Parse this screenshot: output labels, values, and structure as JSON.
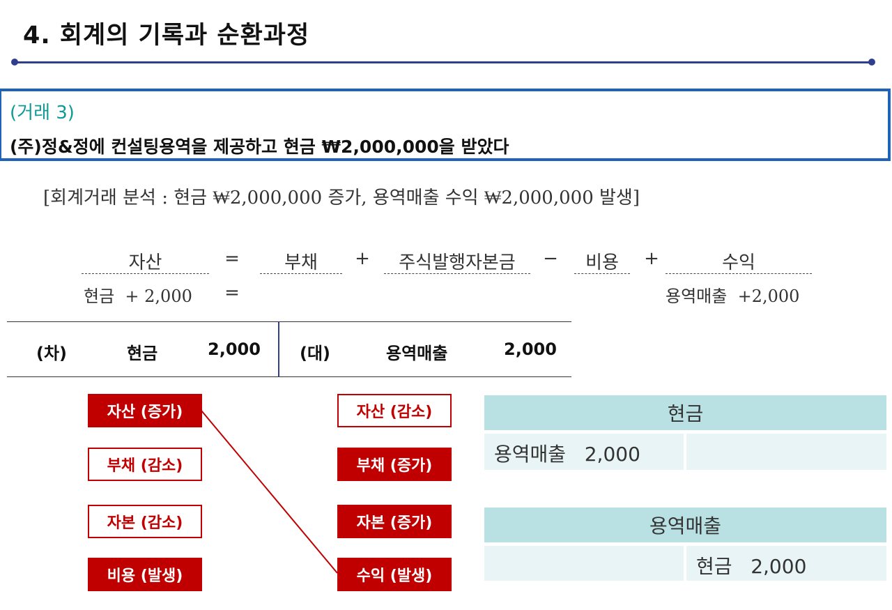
{
  "title": "4. 회계의 기록과 순환과정",
  "transaction": {
    "number": "(거래 3)",
    "description": "(주)정&정에 컨설팅용역을 제공하고 현금 ₩2,000,000을 받았다"
  },
  "analysis": "[회계거래 분석 : 현금 ₩2,000,000 증가, 용역매출 수익 ₩2,000,000 발생]",
  "equation": {
    "terms": [
      "자산",
      "부채",
      "주식발행자본금",
      "비용",
      "수익"
    ],
    "operators": [
      "=",
      "+",
      "−",
      "+"
    ],
    "row_left": "현금  + 2,000",
    "row_equals": "=",
    "row_right": "용역매출  +2,000"
  },
  "journal": {
    "debit_label": "(차)",
    "debit_account": "현금",
    "debit_amount": "2,000",
    "credit_label": "(대)",
    "credit_account": "용역매출",
    "credit_amount": "2,000"
  },
  "debit_tags": [
    {
      "label": "자산 (증가)",
      "style": "filled"
    },
    {
      "label": "부채 (감소)",
      "style": "outline"
    },
    {
      "label": "자본 (감소)",
      "style": "outline"
    },
    {
      "label": "비용 (발생)",
      "style": "filled"
    }
  ],
  "credit_tags": [
    {
      "label": "자산 (감소)",
      "style": "outline"
    },
    {
      "label": "부채 (증가)",
      "style": "filled"
    },
    {
      "label": "자본 (증가)",
      "style": "filled"
    },
    {
      "label": "수익 (발생)",
      "style": "filled"
    }
  ],
  "t_accounts": [
    {
      "name": "현금",
      "debit_entry": "용역매출   2,000",
      "credit_entry": ""
    },
    {
      "name": "용역매출",
      "debit_entry": "",
      "credit_entry": "현금   2,000"
    }
  ],
  "colors": {
    "title_rule": "#2f3f8c",
    "box_border": "#1f63b8",
    "transaction_number": "#0f9a96",
    "tag_red": "#c00000",
    "t_header": "#b9e0e3",
    "t_body": "#e8f4f5"
  }
}
